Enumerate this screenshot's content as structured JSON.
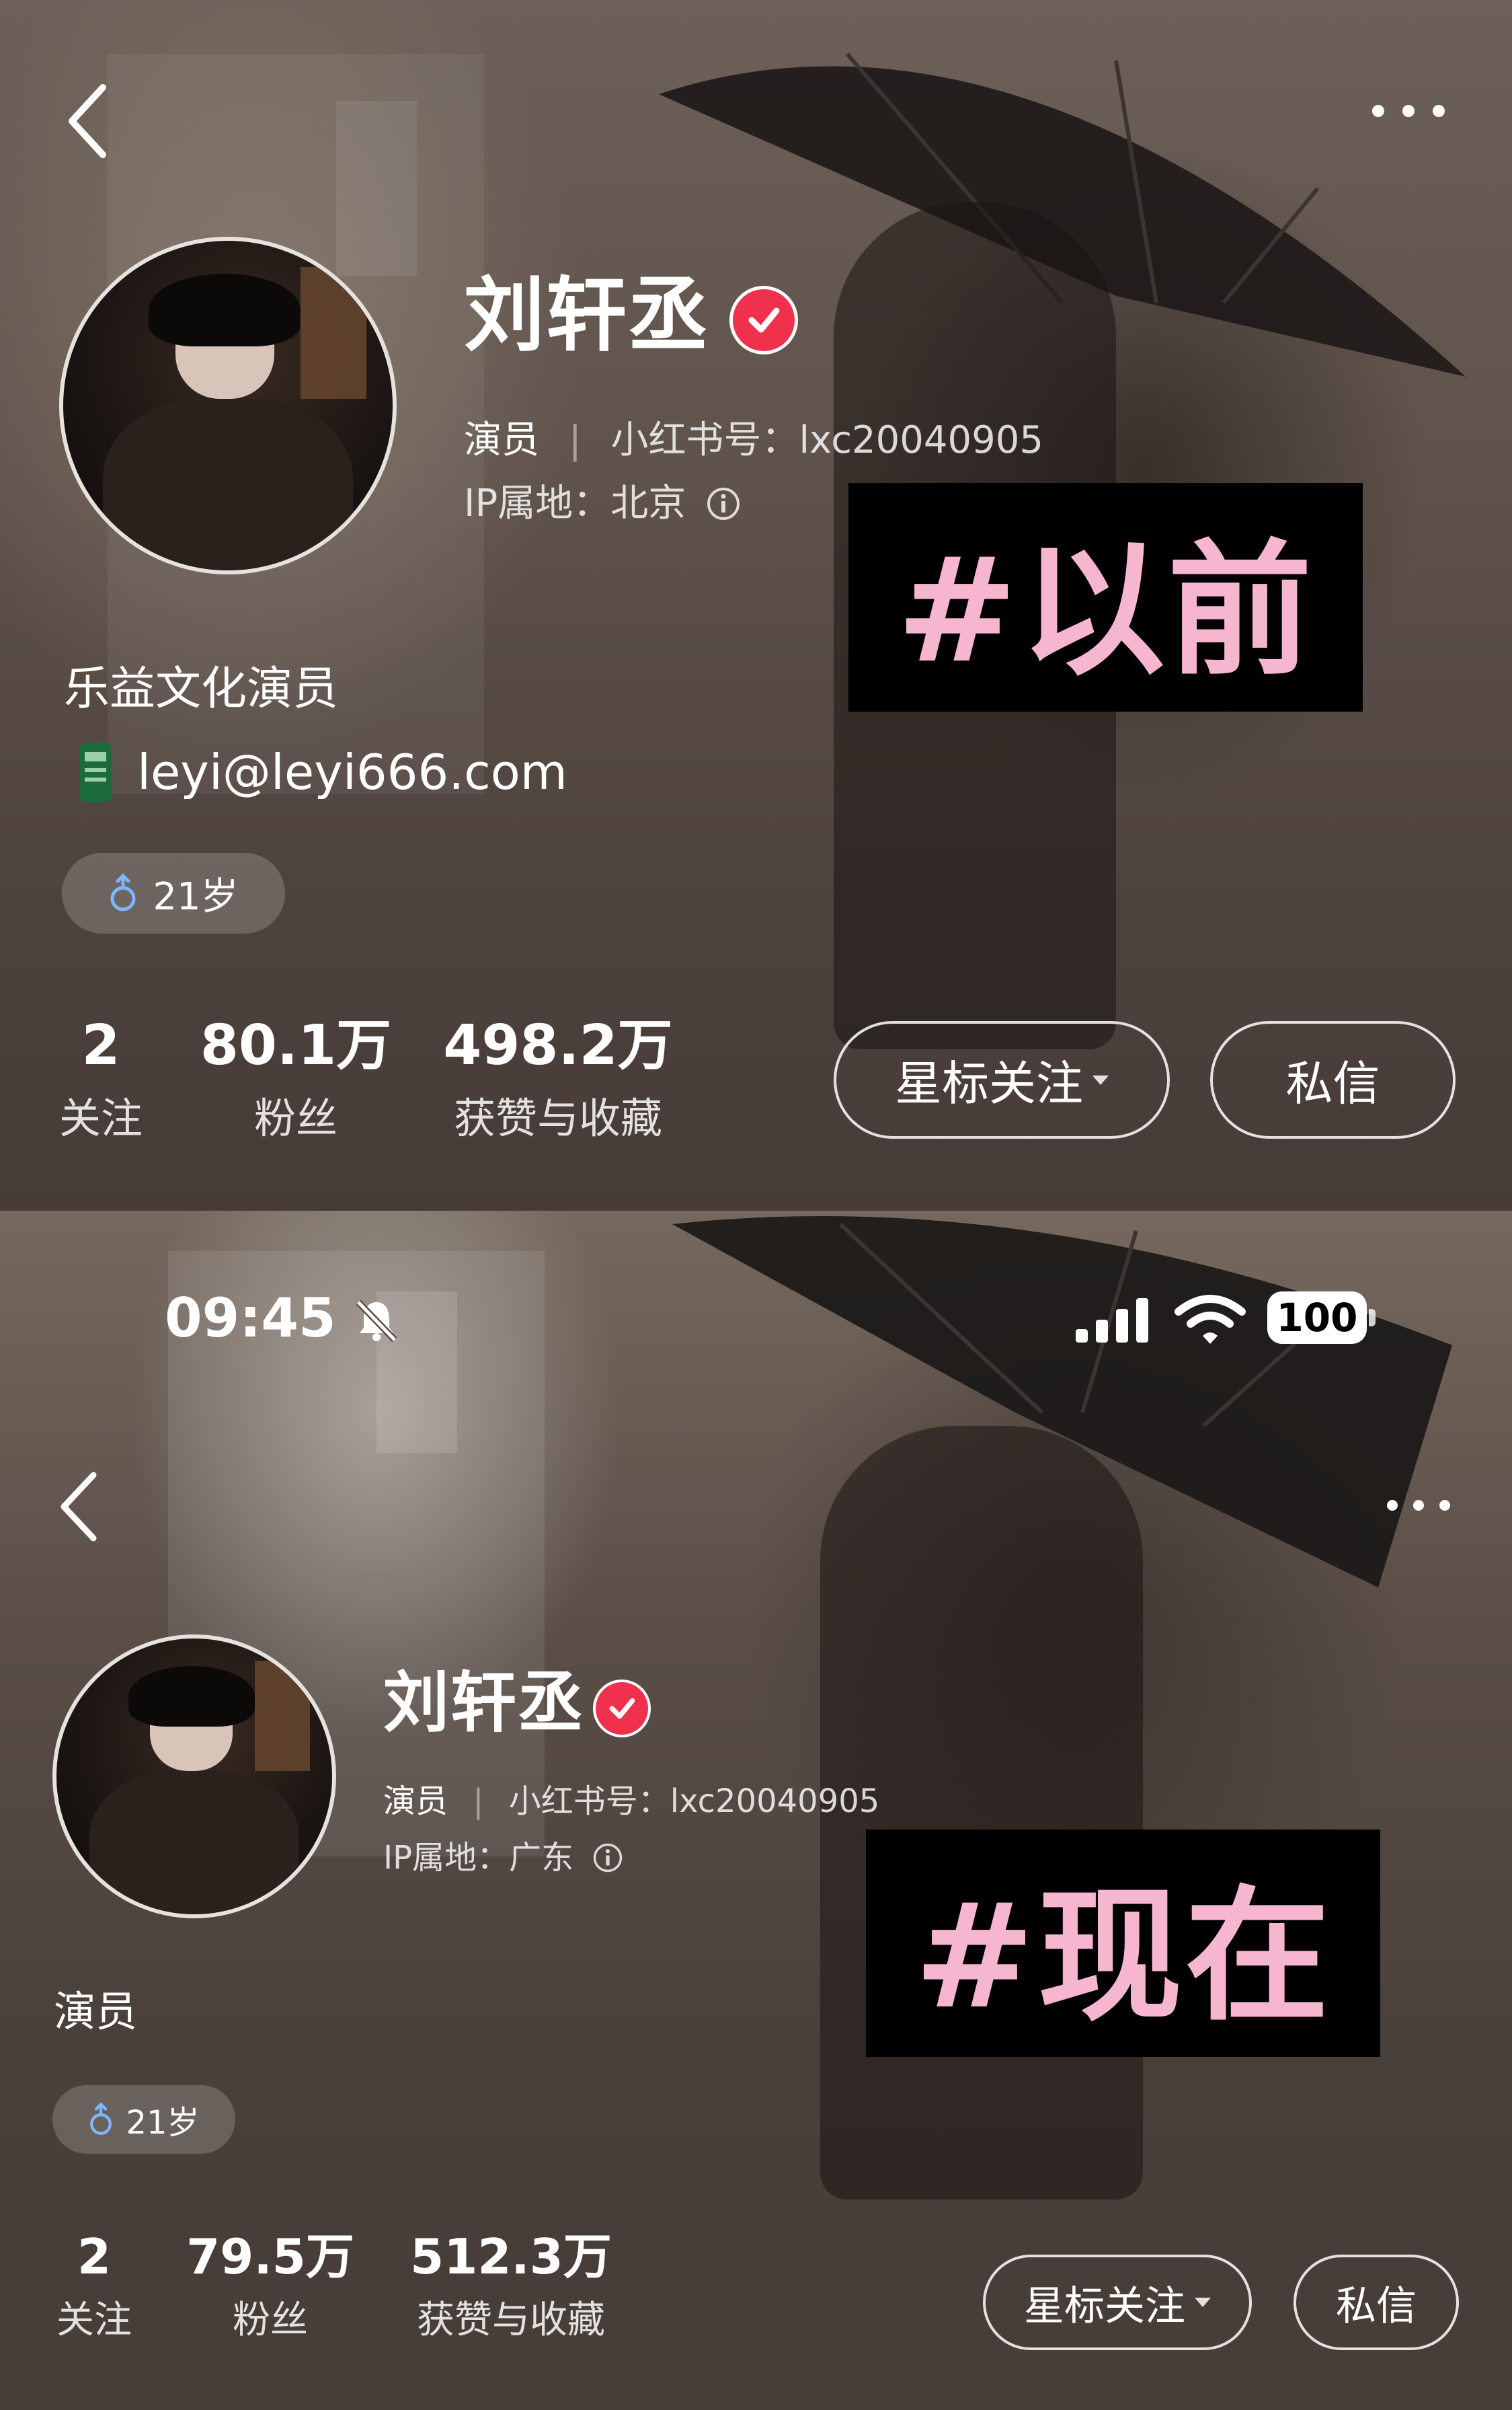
{
  "before": {
    "tag": "#以前",
    "profile": {
      "name": "刘轩丞",
      "role": "演员",
      "rednote_id_label": "小红书号：",
      "rednote_id": "lxc20040905",
      "ip_label": "IP属地：",
      "ip_location": "北京",
      "bio": "乐益文化演员",
      "email": "leyi@leyi666.com",
      "age": "21岁"
    },
    "stats": [
      {
        "value": "2",
        "label": "关注"
      },
      {
        "value": "80.1万",
        "label": "粉丝"
      },
      {
        "value": "498.2万",
        "label": "获赞与收藏"
      }
    ],
    "buttons": {
      "follow": "星标关注",
      "message": "私信"
    }
  },
  "after": {
    "tag": "#现在",
    "status_bar": {
      "time": "09:45",
      "battery": "100"
    },
    "profile": {
      "name": "刘轩丞",
      "role": "演员",
      "rednote_id_label": "小红书号：",
      "rednote_id": "lxc20040905",
      "ip_label": "IP属地：",
      "ip_location": "广东",
      "bio": "演员",
      "age": "21岁"
    },
    "stats": [
      {
        "value": "2",
        "label": "关注"
      },
      {
        "value": "79.5万",
        "label": "粉丝"
      },
      {
        "value": "512.3万",
        "label": "获赞与收藏"
      }
    ],
    "buttons": {
      "follow": "星标关注",
      "message": "私信"
    }
  },
  "icons": {
    "back": "chevron-left-icon",
    "more": "more-dots-icon",
    "verified": "verified-check-icon",
    "info": "info-icon",
    "email": "email-badge-icon",
    "gender": "male-icon",
    "mute": "bell-slash-icon",
    "signal": "signal-bars-icon",
    "wifi": "wifi-icon",
    "battery": "battery-icon"
  },
  "colors": {
    "verified": "#f0314d",
    "tag_text": "#f7b6d0",
    "tag_bg": "#000000"
  }
}
